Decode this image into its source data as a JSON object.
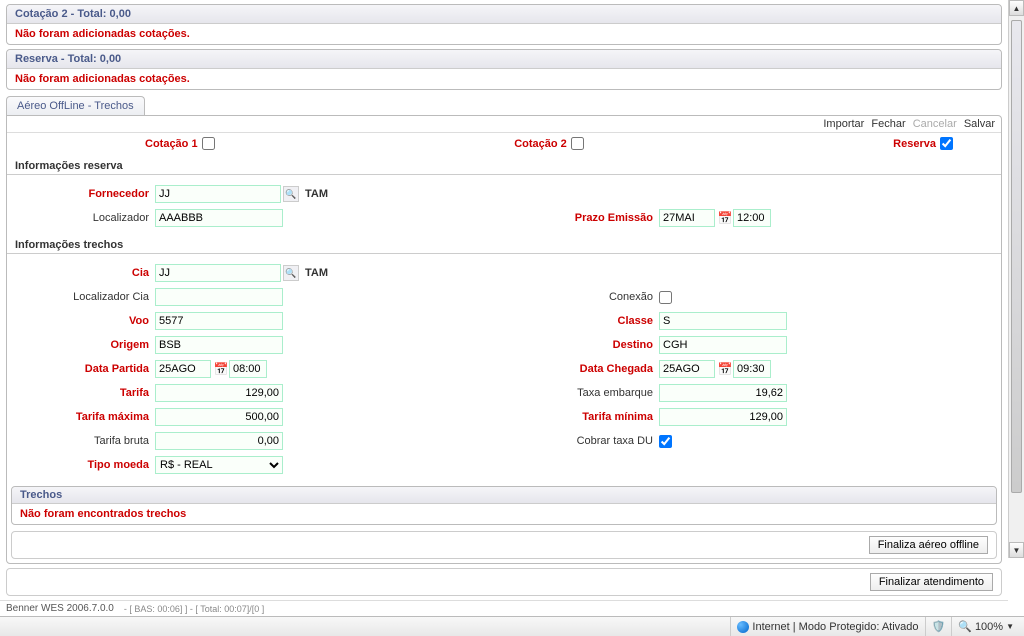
{
  "panels": {
    "cotacao2": {
      "title": "Cotação 2 - Total: 0,00",
      "empty": "Não foram adicionadas cotações."
    },
    "reserva": {
      "title": "Reserva - Total: 0,00",
      "empty": "Não foram adicionadas cotações."
    }
  },
  "tab": {
    "label": "Aéreo OffLine - Trechos"
  },
  "toolbar": {
    "importar": "Importar",
    "fechar": "Fechar",
    "cancelar": "Cancelar",
    "salvar": "Salvar"
  },
  "selectors": {
    "cotacao1": "Cotação 1",
    "cotacao2": "Cotação 2",
    "reserva": "Reserva"
  },
  "section": {
    "inforeserva": "Informações reserva",
    "infotrechos": "Informações trechos"
  },
  "reserva": {
    "fornecedor_lbl": "Fornecedor",
    "fornecedor_val": "JJ",
    "fornecedor_name": "TAM",
    "localizador_lbl": "Localizador",
    "localizador_val": "AAABBB",
    "prazo_lbl": "Prazo Emissão",
    "prazo_date": "27MAI",
    "prazo_time": "12:00"
  },
  "trecho": {
    "cia_lbl": "Cia",
    "cia_val": "JJ",
    "cia_name": "TAM",
    "loccia_lbl": "Localizador Cia",
    "loccia_val": "",
    "conexao_lbl": "Conexão",
    "voo_lbl": "Voo",
    "voo_val": "5577",
    "classe_lbl": "Classe",
    "classe_val": "S",
    "origem_lbl": "Origem",
    "origem_val": "BSB",
    "destino_lbl": "Destino",
    "destino_val": "CGH",
    "partida_lbl": "Data Partida",
    "partida_date": "25AGO",
    "partida_time": "08:00",
    "chegada_lbl": "Data Chegada",
    "chegada_date": "25AGO",
    "chegada_time": "09:30",
    "tarifa_lbl": "Tarifa",
    "tarifa_val": "129,00",
    "taxa_lbl": "Taxa embarque",
    "taxa_val": "19,62",
    "tarifamax_lbl": "Tarifa máxima",
    "tarifamax_val": "500,00",
    "tarifamin_lbl": "Tarifa mínima",
    "tarifamin_val": "129,00",
    "tarifabruta_lbl": "Tarifa bruta",
    "tarifabruta_val": "0,00",
    "cobrar_lbl": "Cobrar taxa DU",
    "moeda_lbl": "Tipo moeda",
    "moeda_val": "R$ - REAL"
  },
  "trechos_panel": {
    "title": "Trechos",
    "empty": "Não foram encontrados trechos"
  },
  "actions": {
    "finaliza_aereo": "Finaliza aéreo offline",
    "finalizar_atend": "Finalizar atendimento"
  },
  "footer": {
    "app": "Benner WES 2006.7.0.0",
    "stats": "- [ BAS: 00:06] ] - [ Total: 00:07]/[0 ]"
  },
  "status": {
    "internet": "Internet | Modo Protegido: Ativado",
    "zoom": "100%"
  }
}
